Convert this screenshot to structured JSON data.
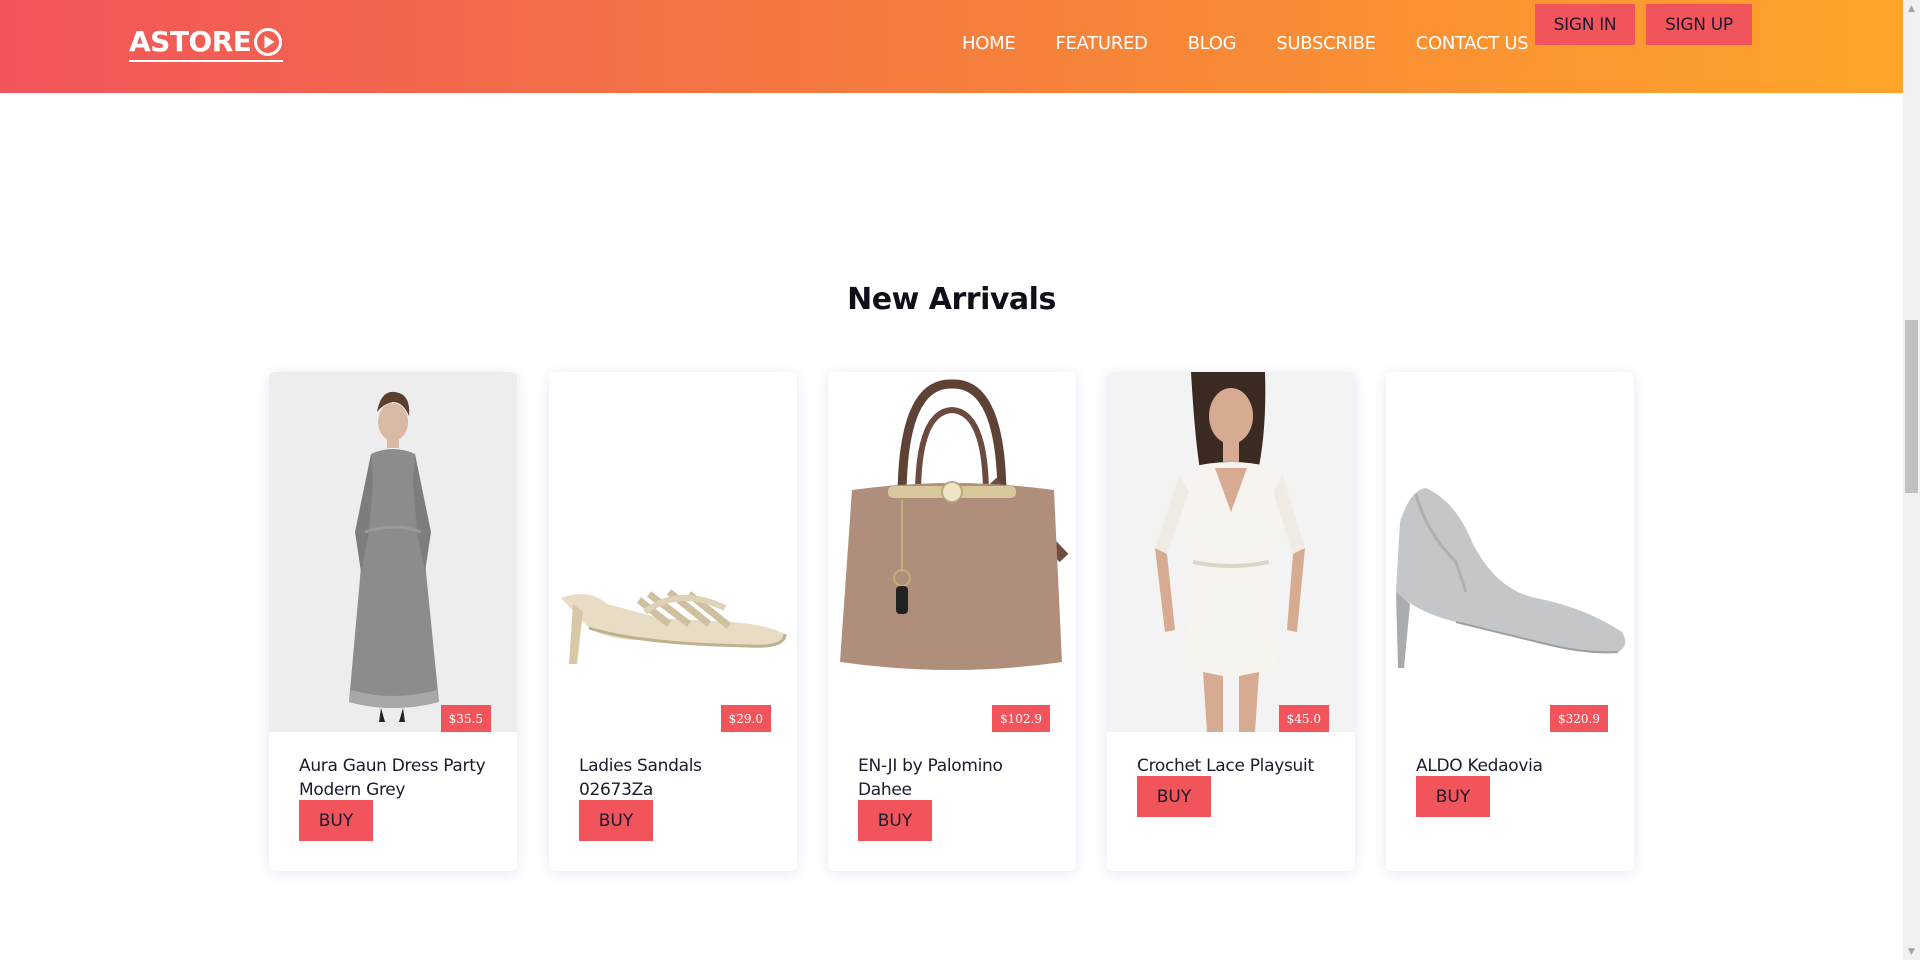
{
  "header": {
    "logo_text": "ASTORE",
    "nav": [
      "HOME",
      "FEATURED",
      "BLOG",
      "SUBSCRIBE",
      "CONTACT US"
    ],
    "signin_label": "SIGN IN",
    "signup_label": "SIGN UP",
    "gradient_start": "#f2545b",
    "gradient_end": "#ffa52a"
  },
  "section": {
    "title": "New Arrivals"
  },
  "products": [
    {
      "name": "Aura Gaun Dress Party Modern Grey",
      "price": "$35.5",
      "buy_label": "BUY",
      "image_icon": "dress-image"
    },
    {
      "name": "Ladies Sandals 02673Za",
      "price": "$29.0",
      "buy_label": "BUY",
      "image_icon": "sandal-image"
    },
    {
      "name": "EN-JI by Palomino Dahee",
      "price": "$102.9",
      "buy_label": "BUY",
      "image_icon": "handbag-image"
    },
    {
      "name": "Crochet Lace Playsuit",
      "price": "$45.0",
      "buy_label": "BUY",
      "image_icon": "playsuit-image"
    },
    {
      "name": "ALDO Kedaovia",
      "price": "$320.9",
      "buy_label": "BUY",
      "image_icon": "heel-image"
    }
  ],
  "colors": {
    "accent": "#f2545b",
    "text": "#1b1b2f"
  }
}
